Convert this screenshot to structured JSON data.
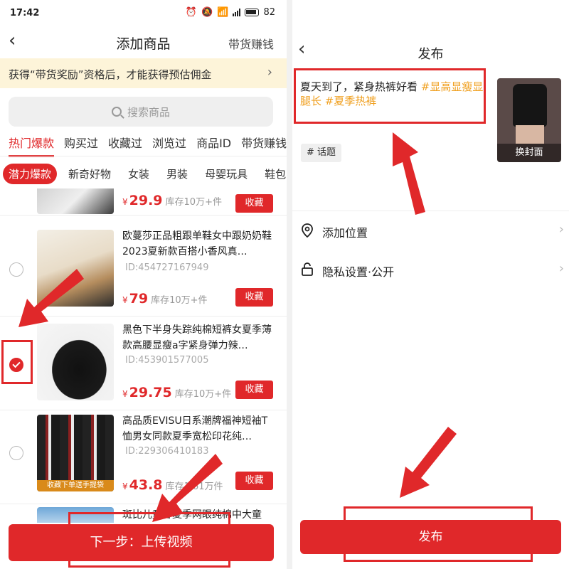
{
  "status_bar": {
    "time": "17:42",
    "battery": "82"
  },
  "left": {
    "title": "添加商品",
    "right_link": "带货赚钱",
    "banner": "获得“带货奖励”资格后，才能获得预估佣金",
    "search_placeholder": "搜索商品",
    "tabs": [
      "热门爆款",
      "购买过",
      "收藏过",
      "浏览过",
      "商品ID",
      "带货赚钱"
    ],
    "chips": [
      "潜力爆款",
      "新奇好物",
      "女装",
      "男装",
      "母婴玩具",
      "鞋包"
    ],
    "products": [
      {
        "title": "",
        "id": "",
        "price": "29.9",
        "stock": "库存10万+件",
        "fav": "收藏",
        "checked": false
      },
      {
        "title": "欧蔓莎正品粗跟单鞋女中跟奶奶鞋2023夏新款百搭小香风真…",
        "id": "ID:454727167949",
        "price": "79",
        "stock": "库存10万+件",
        "fav": "收藏",
        "checked": false
      },
      {
        "title": "黑色下半身失踪纯棉短裤女夏季薄款高腰显瘦a字紧身弹力辣…",
        "id": "ID:453901577005",
        "price": "29.75",
        "stock": "库存10万+件",
        "fav": "收藏",
        "checked": true
      },
      {
        "title": "高品质EVISU日系潮牌福神短袖T恤男女同款夏季宽松印花纯…",
        "id": "ID:229306410183",
        "price": "43.8",
        "stock": "库存1.61万件",
        "fav": "收藏",
        "checked": false
      },
      {
        "title": "斑比儿童春夏季网眼纯棉中大童",
        "id": "",
        "price": "",
        "stock": "",
        "fav": "",
        "checked": false
      }
    ],
    "currency": "¥",
    "thumb_badge": "收藏下单送手提袋",
    "next_button": "下一步：上传视频"
  },
  "right": {
    "title": "发布",
    "caption_text": "夏天到了，紧身热裤好看 ",
    "caption_tags": "#显高显瘦显腿长 #夏季热裤",
    "cover_label": "换封面",
    "topic_chip": "# 话题",
    "settings": [
      {
        "label": "添加位置",
        "icon": "location-icon"
      },
      {
        "label": "隐私设置·公开",
        "icon": "lock-icon"
      }
    ],
    "publish_button": "发布"
  },
  "colors": {
    "accent": "#e0282a",
    "tag": "#f0a020",
    "banner_bg": "#fdf4d9"
  }
}
